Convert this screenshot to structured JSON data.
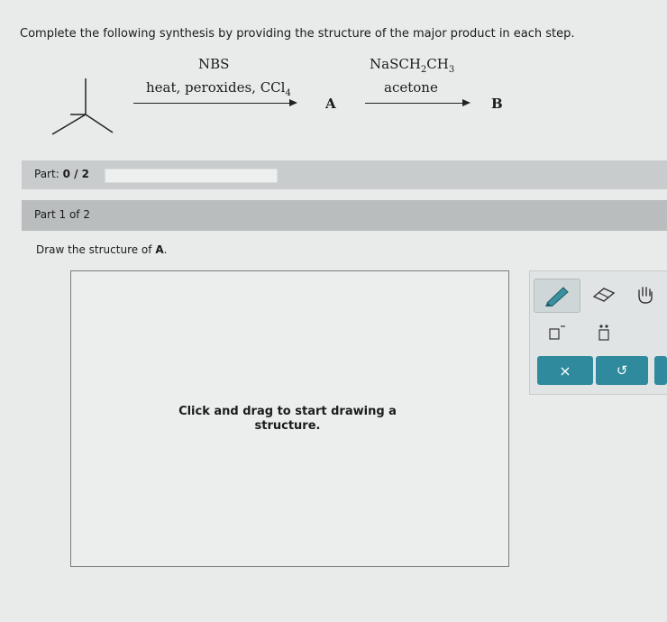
{
  "instruction": "Complete the following synthesis by providing the structure of the major product in each step.",
  "scheme": {
    "step1": {
      "above": "NBS",
      "below": "heat, peroxides, CCl",
      "below_sub": "4"
    },
    "product_a": "A",
    "step2": {
      "above_parts": [
        "NaSCH",
        "2",
        "CH",
        "3"
      ],
      "below": "acetone"
    },
    "product_b": "B"
  },
  "part_status": {
    "label": "Part:",
    "value": "0 / 2",
    "progress": 0
  },
  "part_tab": {
    "label": "Part 1 of 2"
  },
  "question": {
    "prefix": "Draw the structure of ",
    "target": "A",
    "suffix": "."
  },
  "canvas": {
    "hint": "Click and drag to start drawing a structure."
  },
  "tools": {
    "pencil": "pencil-icon",
    "eraser": "eraser-icon",
    "hand": "hand-icon",
    "bracket": "bracket-icon",
    "lone_pair": "lone-pair-icon",
    "clear": "×",
    "undo": "↺"
  },
  "colors": {
    "accent": "#2e8a9c",
    "page_bg": "#e9eaea"
  }
}
